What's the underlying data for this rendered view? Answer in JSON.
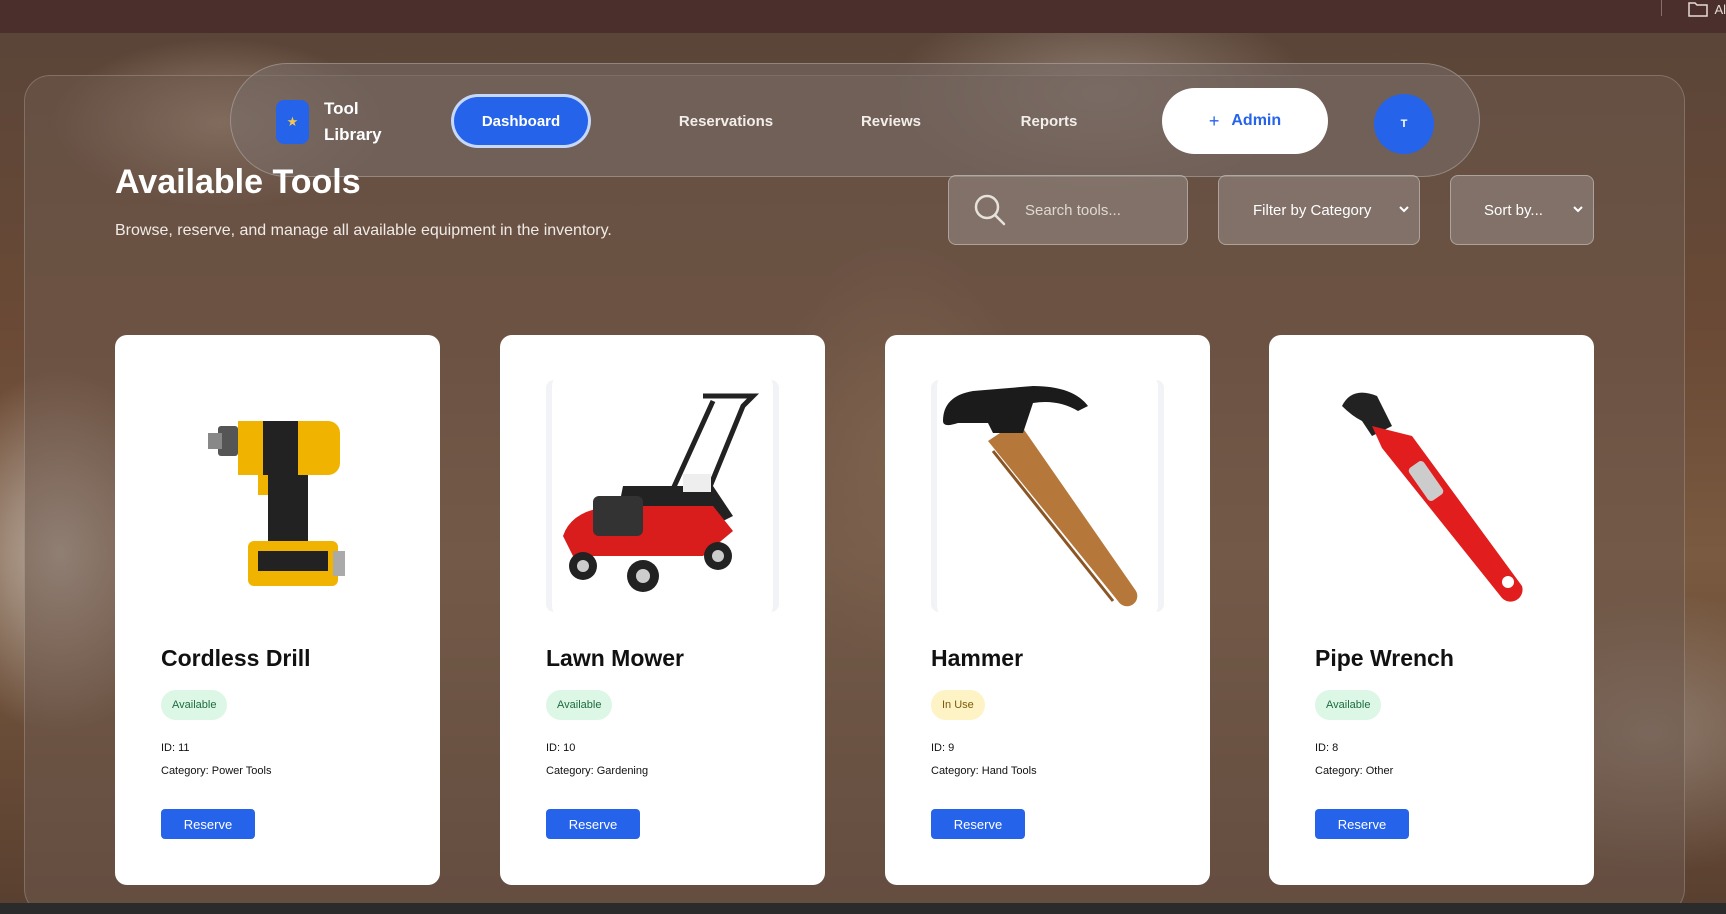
{
  "browser": {
    "bookmark_label": "Al"
  },
  "nav": {
    "brand": "Tool Library",
    "items": [
      {
        "label": "Dashboard",
        "active": true
      },
      {
        "label": "Reservations",
        "active": false
      },
      {
        "label": "Reviews",
        "active": false
      },
      {
        "label": "Reports",
        "active": false
      }
    ],
    "admin_label": "Admin",
    "avatar_initial": "T"
  },
  "header": {
    "title": "Available Tools",
    "subtitle": "Browse, reserve, and manage all available equipment in the inventory."
  },
  "controls": {
    "search_placeholder": "Search tools...",
    "filter_label": "Filter by Category",
    "sort_label": "Sort by..."
  },
  "tools": [
    {
      "name": "Cordless Drill",
      "status": "Available",
      "id": "ID: 11",
      "category": "Category: Power Tools",
      "action": "Reserve",
      "icon": "drill-image"
    },
    {
      "name": "Lawn Mower",
      "status": "Available",
      "id": "ID: 10",
      "category": "Category: Gardening",
      "action": "Reserve",
      "icon": "lawn-mower-image"
    },
    {
      "name": "Hammer",
      "status": "In Use",
      "id": "ID: 9",
      "category": "Category: Hand Tools",
      "action": "Reserve",
      "icon": "hammer-image"
    },
    {
      "name": "Pipe Wrench",
      "status": "Available",
      "id": "ID: 8",
      "category": "Category: Other",
      "action": "Reserve",
      "icon": "pipe-wrench-image"
    }
  ],
  "colors": {
    "accent": "#2563eb",
    "available_bg": "#dcf7e6",
    "inuse_bg": "#fdf3c4"
  }
}
